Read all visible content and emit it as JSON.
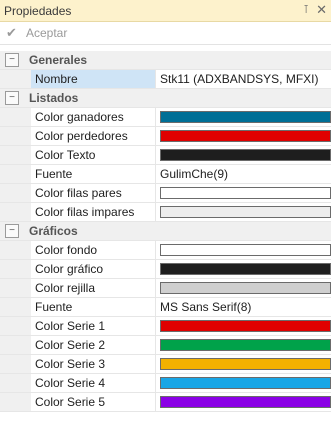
{
  "panel": {
    "title": "Propiedades",
    "pin_icon": "pin-icon",
    "close_icon": "close-icon"
  },
  "toolbar": {
    "accept_label": "Aceptar",
    "accept_icon": "check-icon"
  },
  "categories": [
    {
      "name": "Generales",
      "toggle": "⊟",
      "rows": [
        {
          "label": "Nombre",
          "value": "Stk11 (ADXBANDSYS, MFXI)"
        }
      ]
    },
    {
      "name": "Listados",
      "toggle": "⊟",
      "rows": [
        {
          "label": "Color ganadores",
          "color": "#006f96"
        },
        {
          "label": "Color perdedores",
          "color": "#e00000"
        },
        {
          "label": "Color Texto",
          "color": "#1e1e1e"
        },
        {
          "label": "Fuente",
          "value": "GulimChe(9)"
        },
        {
          "label": "Color filas pares",
          "color": "#ffffff"
        },
        {
          "label": "Color filas impares",
          "color": "#ededed"
        }
      ]
    },
    {
      "name": "Gráficos",
      "toggle": "⊟",
      "rows": [
        {
          "label": "Color fondo",
          "color": "#ffffff"
        },
        {
          "label": "Color gráfico",
          "color": "#1e1e1e"
        },
        {
          "label": "Color rejilla",
          "color": "#cfcfcf"
        },
        {
          "label": "Fuente",
          "value": "MS Sans Serif(8)"
        },
        {
          "label": "Color Serie 1",
          "color": "#e00000"
        },
        {
          "label": "Color Serie 2",
          "color": "#00a24a"
        },
        {
          "label": "Color Serie 3",
          "color": "#f3b100"
        },
        {
          "label": "Color Serie 4",
          "color": "#19a6e6"
        },
        {
          "label": "Color Serie 5",
          "color": "#8b00e6"
        }
      ]
    }
  ]
}
